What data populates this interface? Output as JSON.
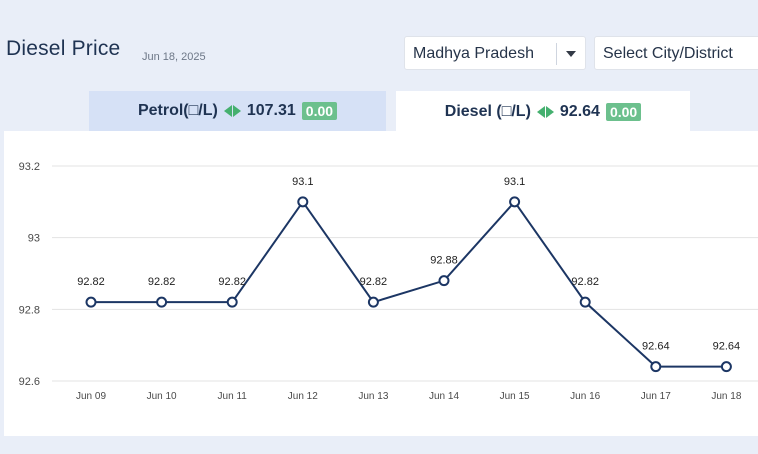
{
  "header": {
    "title": "Diesel Price",
    "date": "Jun 18, 2025"
  },
  "filters": {
    "state": "Madhya Pradesh",
    "city_placeholder": "Select City/District"
  },
  "tabs": {
    "petrol": {
      "label": "Petrol(□/L)",
      "price": "107.31",
      "change": "0.00"
    },
    "diesel": {
      "label": "Diesel (□/L)",
      "price": "92.64",
      "change": "0.00",
      "active": true
    }
  },
  "colors": {
    "line": "#1c3664",
    "grid": "#e3e3e3",
    "change_badge": "#6cc08d",
    "arrow": "#45b06f"
  },
  "icons": {
    "up_down_arrow": "left-right-triangle-icon",
    "dropdown": "caret-down-icon"
  },
  "chart_data": {
    "type": "line",
    "categories": [
      "Jun 09",
      "Jun 10",
      "Jun 11",
      "Jun 12",
      "Jun 13",
      "Jun 14",
      "Jun 15",
      "Jun 16",
      "Jun 17",
      "Jun 18"
    ],
    "series": [
      {
        "values": [
          92.82,
          92.82,
          92.82,
          93.1,
          92.82,
          92.88,
          93.1,
          92.82,
          92.64,
          92.64
        ]
      }
    ],
    "data_labels": [
      "92.82",
      "92.82",
      "92.82",
      "93.1",
      "92.82",
      "92.88",
      "93.1",
      "92.82",
      "92.64",
      "92.64"
    ],
    "yticks": [
      92.6,
      92.8,
      93,
      93.2
    ],
    "ytick_labels": [
      "92.6",
      "92.8",
      "93",
      "93.2"
    ],
    "ylim": [
      92.6,
      93.2
    ],
    "grid": true,
    "markers": "hollow-circle"
  }
}
